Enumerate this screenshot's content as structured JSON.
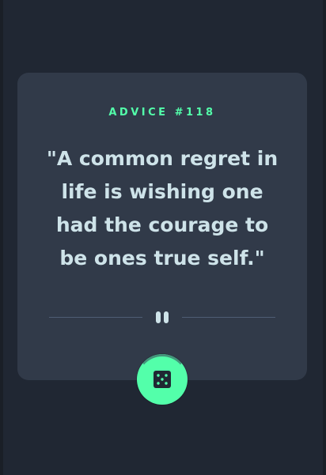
{
  "advice": {
    "id_label": "ADVICE #118",
    "quote": "\"A common regret in life is wishing one had the courage to be ones true self.\""
  },
  "icons": {
    "divider": "pause-icon",
    "generate": "dice-icon"
  },
  "colors": {
    "background": "#202733",
    "card": "#313a49",
    "accent": "#53ffaa",
    "text": "#cee3e9",
    "divider": "#4f5d74"
  }
}
